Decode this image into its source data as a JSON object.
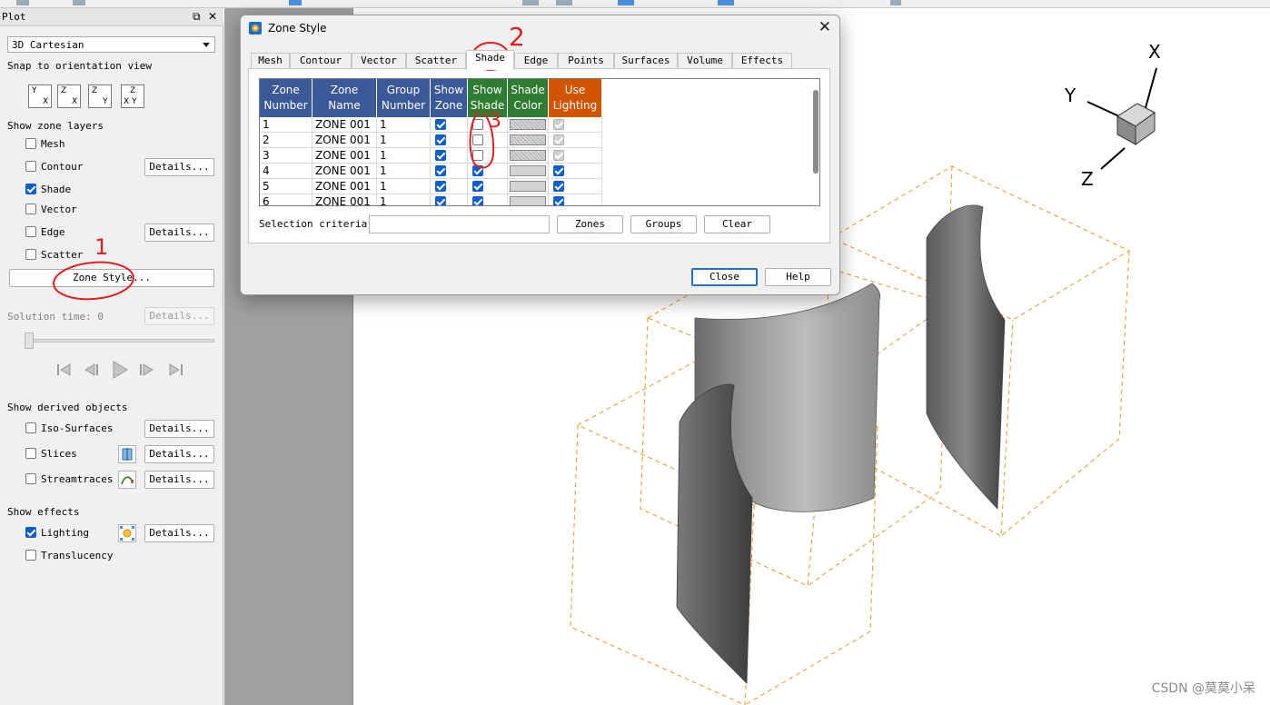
{
  "sidebar": {
    "title": "Plot",
    "plot_type": "3D Cartesian",
    "snap_label": "Snap to orientation view",
    "orient_buttons": [
      {
        "top": "Y",
        "bottom": "X"
      },
      {
        "top": "Z",
        "bottom": "X"
      },
      {
        "top": "Z",
        "bottom": "Y"
      },
      {
        "top": "Z",
        "bottom": "X Y"
      }
    ],
    "zone_layers_label": "Show zone layers",
    "layers": [
      {
        "label": "Mesh",
        "checked": false
      },
      {
        "label": "Contour",
        "checked": false
      },
      {
        "label": "Shade",
        "checked": true
      },
      {
        "label": "Vector",
        "checked": false
      },
      {
        "label": "Edge",
        "checked": false
      },
      {
        "label": "Scatter",
        "checked": false
      }
    ],
    "details_label": "Details...",
    "zone_style_label": "Zone Style...",
    "solution_time_label": "Solution time: 0",
    "derived_label": "Show derived objects",
    "derived": [
      {
        "label": "Iso-Surfaces",
        "checked": false
      },
      {
        "label": "Slices",
        "checked": false
      },
      {
        "label": "Streamtraces",
        "checked": false
      }
    ],
    "effects_label": "Show effects",
    "effects": [
      {
        "label": "Lighting",
        "checked": true
      },
      {
        "label": "Translucency",
        "checked": false
      }
    ]
  },
  "dialog": {
    "title": "Zone Style",
    "tabs": [
      "Mesh",
      "Contour",
      "Vector",
      "Scatter",
      "Shade",
      "Edge",
      "Points",
      "Surfaces",
      "Volume",
      "Effects"
    ],
    "active_tab": "Shade",
    "columns": [
      {
        "line1": "Zone",
        "line2": "Number"
      },
      {
        "line1": "Zone",
        "line2": "Name"
      },
      {
        "line1": "Group",
        "line2": "Number"
      },
      {
        "line1": "Show",
        "line2": "Zone"
      },
      {
        "line1": "Show",
        "line2": "Shade"
      },
      {
        "line1": "Shade",
        "line2": "Color"
      },
      {
        "line1": "Use",
        "line2": "Lighting"
      }
    ],
    "rows": [
      {
        "number": "1",
        "name": "ZONE 001",
        "group": "1",
        "show_zone": true,
        "show_shade": false,
        "lighting": "disabled"
      },
      {
        "number": "2",
        "name": "ZONE 001",
        "group": "1",
        "show_zone": true,
        "show_shade": false,
        "lighting": "disabled"
      },
      {
        "number": "3",
        "name": "ZONE 001",
        "group": "1",
        "show_zone": true,
        "show_shade": false,
        "lighting": "disabled"
      },
      {
        "number": "4",
        "name": "ZONE 001",
        "group": "1",
        "show_zone": true,
        "show_shade": true,
        "lighting": "on"
      },
      {
        "number": "5",
        "name": "ZONE 001",
        "group": "1",
        "show_zone": true,
        "show_shade": true,
        "lighting": "on"
      },
      {
        "number": "6",
        "name": "ZONE 001",
        "group": "1",
        "show_zone": true,
        "show_shade": true,
        "lighting": "on"
      }
    ],
    "selection_label": "Selection criteria:",
    "selection_value": "",
    "zones_btn": "Zones",
    "groups_btn": "Groups",
    "clear_btn": "Clear",
    "close_btn": "Close",
    "help_btn": "Help"
  },
  "axes": {
    "x": "X",
    "y": "Y",
    "z": "Z"
  },
  "annotations": {
    "n1": "1",
    "n2": "2",
    "n3": "3"
  },
  "watermark": "CSDN @莫莫小呆",
  "colors": {
    "header_blue": "#3b5998",
    "header_green": "#2e7d32",
    "header_orange": "#d35400",
    "check_blue": "#0d5fce",
    "bbox_orange": "#f0932b",
    "annotation_red": "#e02020"
  }
}
